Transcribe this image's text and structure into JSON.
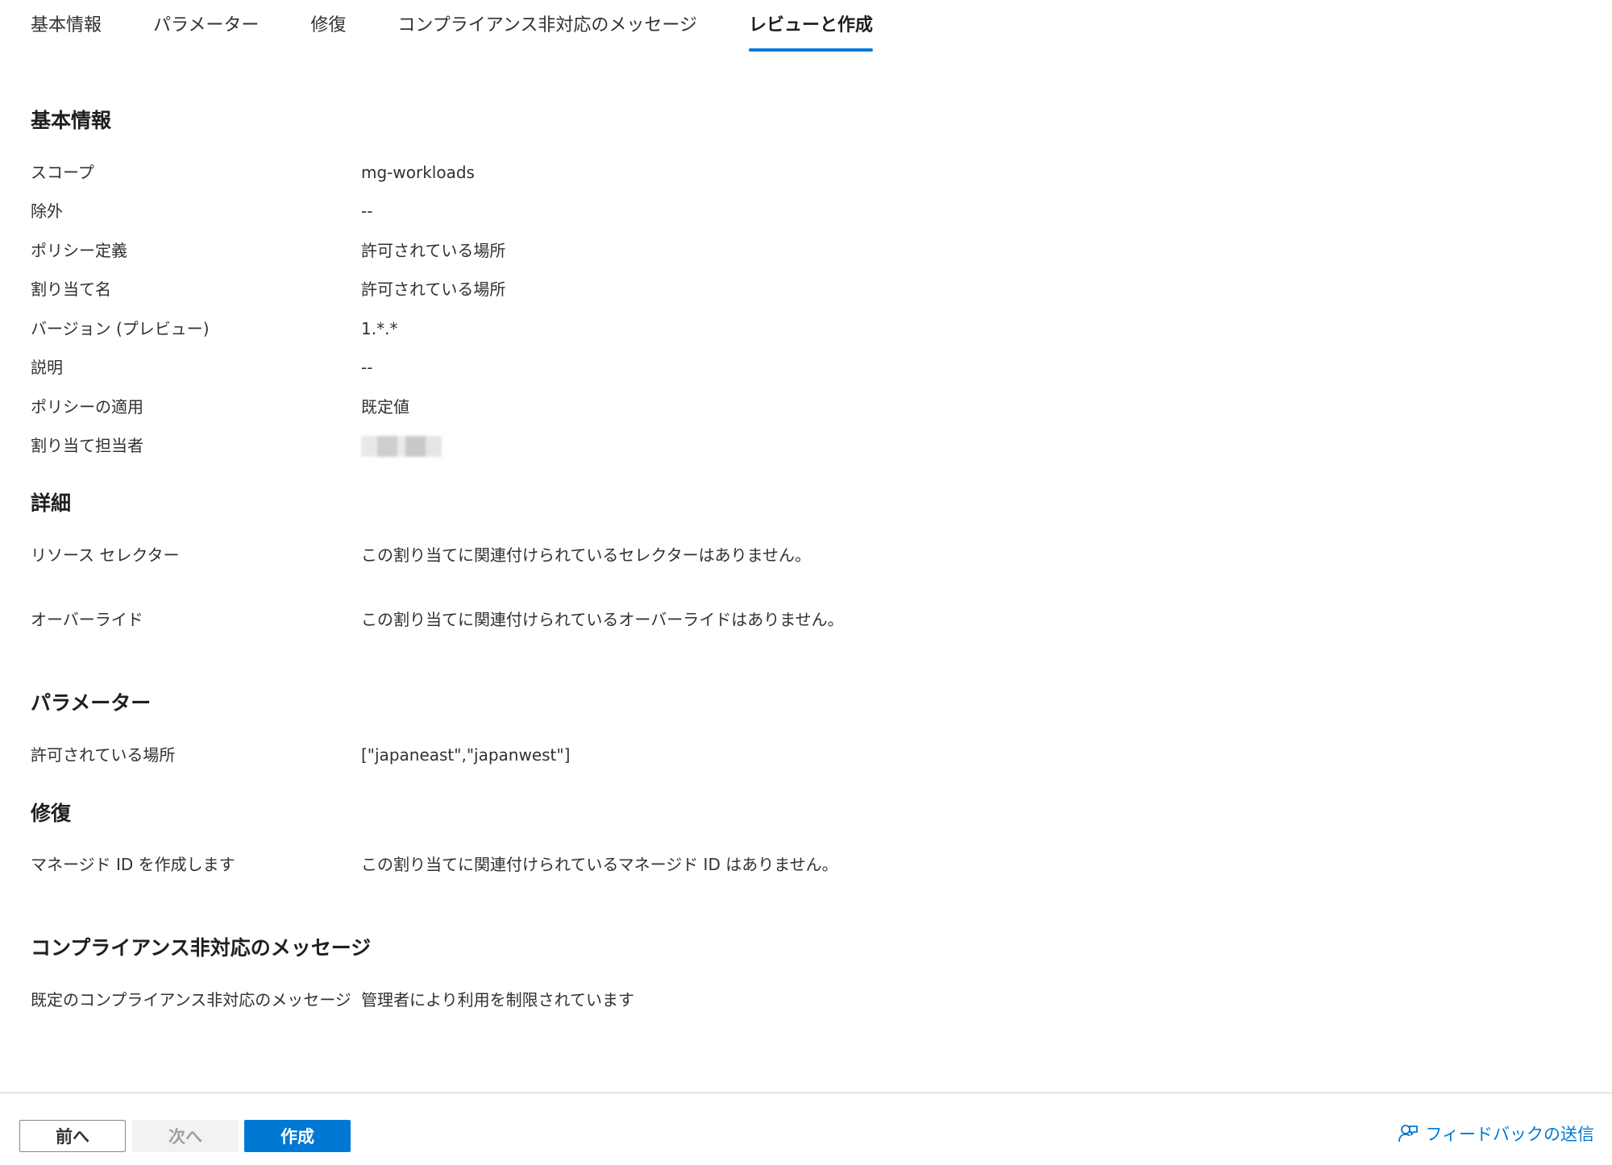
{
  "tabs": [
    {
      "label": "基本情報",
      "active": false
    },
    {
      "label": "パラメーター",
      "active": false
    },
    {
      "label": "修復",
      "active": false
    },
    {
      "label": "コンプライアンス非対応のメッセージ",
      "active": false
    },
    {
      "label": "レビューと作成",
      "active": true
    }
  ],
  "sections": {
    "basics": {
      "title": "基本情報",
      "rows": [
        {
          "label": "スコープ",
          "value": "mg-workloads"
        },
        {
          "label": "除外",
          "value": "--"
        },
        {
          "label": "ポリシー定義",
          "value": "許可されている場所"
        },
        {
          "label": "割り当て名",
          "value": "許可されている場所"
        },
        {
          "label": "バージョン (プレビュー)",
          "value": "1.*.*"
        },
        {
          "label": "説明",
          "value": "--"
        },
        {
          "label": "ポリシーの適用",
          "value": "既定値"
        },
        {
          "label": "割り当て担当者",
          "value": ""
        }
      ]
    },
    "advanced": {
      "title": "詳細",
      "rows": [
        {
          "label": "リソース セレクター",
          "value": "この割り当てに関連付けられているセレクターはありません。"
        },
        {
          "label": "オーバーライド",
          "value": "この割り当てに関連付けられているオーバーライドはありません。"
        }
      ]
    },
    "parameters": {
      "title": "パラメーター",
      "rows": [
        {
          "label": "許可されている場所",
          "value": "[\"japaneast\",\"japanwest\"]"
        }
      ]
    },
    "remediation": {
      "title": "修復",
      "rows": [
        {
          "label": "マネージド ID を作成します",
          "value": "この割り当てに関連付けられているマネージド ID はありません。"
        }
      ]
    },
    "noncompliance": {
      "title": "コンプライアンス非対応のメッセージ",
      "rows": [
        {
          "label": "既定のコンプライアンス非対応のメッセージ",
          "value": "管理者により利用を制限されています"
        }
      ]
    }
  },
  "footer": {
    "prev_label": "前へ",
    "next_label": "次へ",
    "create_label": "作成",
    "feedback_label": "フィードバックの送信",
    "feedback_icon": "feedback-person-icon"
  },
  "colors": {
    "accent": "#0078d4",
    "text": "#323130",
    "disabled_bg": "#f3f2f1",
    "disabled_text": "#a19f9d"
  }
}
